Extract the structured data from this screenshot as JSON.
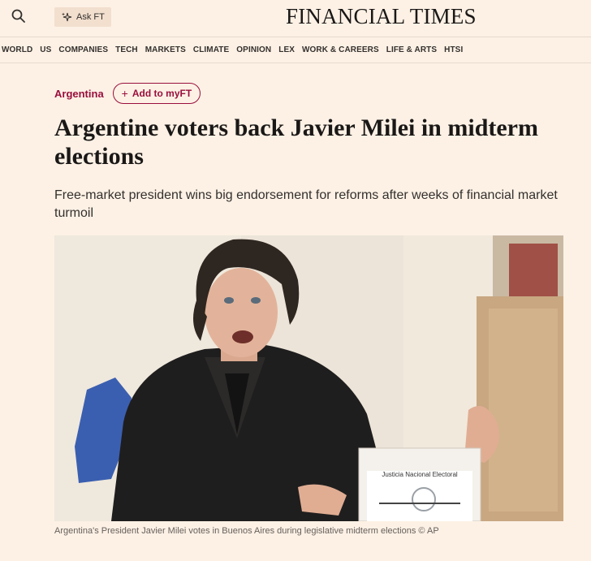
{
  "header": {
    "ask_label": "Ask FT",
    "masthead": "FINANCIAL TIMES"
  },
  "nav": {
    "items": [
      "WORLD",
      "US",
      "COMPANIES",
      "TECH",
      "MARKETS",
      "CLIMATE",
      "OPINION",
      "LEX",
      "WORK & CAREERS",
      "LIFE & ARTS",
      "HTSI"
    ]
  },
  "article": {
    "topic": "Argentina",
    "add_myft": "Add to myFT",
    "headline": "Argentine voters back Javier Milei in midterm elections",
    "standfirst": "Free-market president wins big endorsement for reforms after weeks of financial market turmoil",
    "caption": "Argentina's President Javier Milei votes in Buenos Aires during legislative midterm elections © AP"
  },
  "photo": {
    "ballot_box_label": "Justicia Nacional Electoral"
  },
  "colors": {
    "background": "#fdf1e5",
    "accent": "#990f3d",
    "ask_bg": "#f2dfce"
  }
}
